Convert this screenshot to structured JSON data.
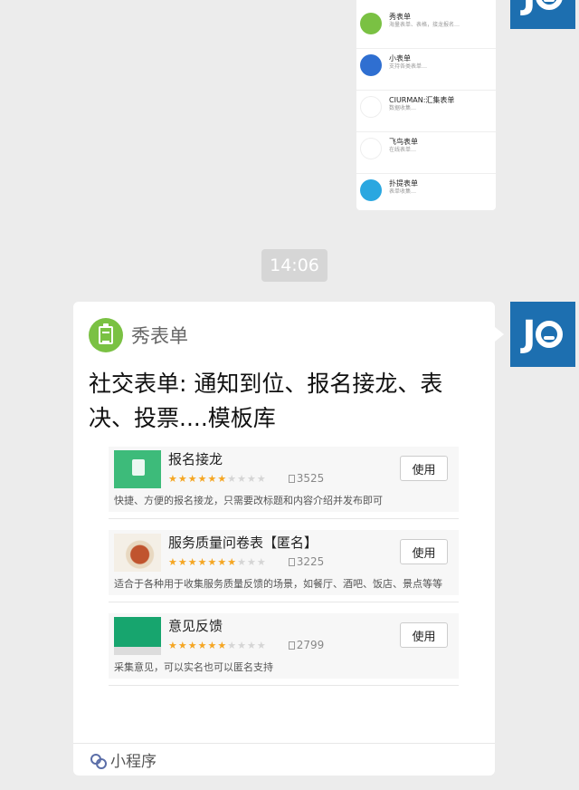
{
  "previous_message": {
    "items": [
      {
        "icon": "clipboard-icon",
        "color": "#7ac143",
        "name": "秀表单",
        "desc": "海量表单、表格，接龙报名…"
      },
      {
        "icon": "document-icon",
        "color": "#2f6fd1",
        "name": "小表单",
        "desc": "支持各类表单…"
      },
      {
        "icon": "wings-logo-icon",
        "color": "#ffffff",
        "name": "CIURMAN:汇集表单",
        "desc": "数据收集…"
      },
      {
        "icon": "bird-icon",
        "color": "#ffffff",
        "name": "飞鸟表单",
        "desc": "在线表单…"
      },
      {
        "icon": "d-letter-icon",
        "color": "#2aa7e0",
        "name": "扑提表单",
        "desc": "表单收集…"
      }
    ]
  },
  "timestamp": "14:06",
  "card": {
    "app_icon": "clipboard-icon",
    "app_name": "秀表单",
    "title": "社交表单: 通知到位、报名接龙、表决、投票....模板库",
    "templates": [
      {
        "name": "报名接龙",
        "stars_on": 6,
        "stars_total": 10,
        "uses": "3525",
        "button": "使用",
        "desc": "快捷、方便的报名接龙，只需要改标题和内容介绍并发布即可",
        "thumb": "green-form-thumbnail"
      },
      {
        "name": "服务质量问卷表【匿名】",
        "stars_on": 7,
        "stars_total": 10,
        "uses": "3225",
        "button": "使用",
        "desc": "适合于各种用于收集服务质量反馈的场景，如餐厅、酒吧、饭店、景点等等",
        "thumb": "food-thumbnail"
      },
      {
        "name": "意见反馈",
        "stars_on": 6,
        "stars_total": 10,
        "uses": "2799",
        "button": "使用",
        "desc": "采集意见，可以实名也可以匿名支持",
        "thumb": "green-feedback-thumbnail"
      }
    ],
    "footer_icon": "mini-program-icon",
    "footer_label": "小程序"
  },
  "avatar": {
    "icon": "jo-logo-icon",
    "color": "#1d6fb0",
    "text": "JO"
  },
  "colors": {
    "background": "#ececec",
    "accent_green": "#7ac143",
    "star": "#f5a623",
    "timestamp_bg": "#d6d6d6"
  }
}
